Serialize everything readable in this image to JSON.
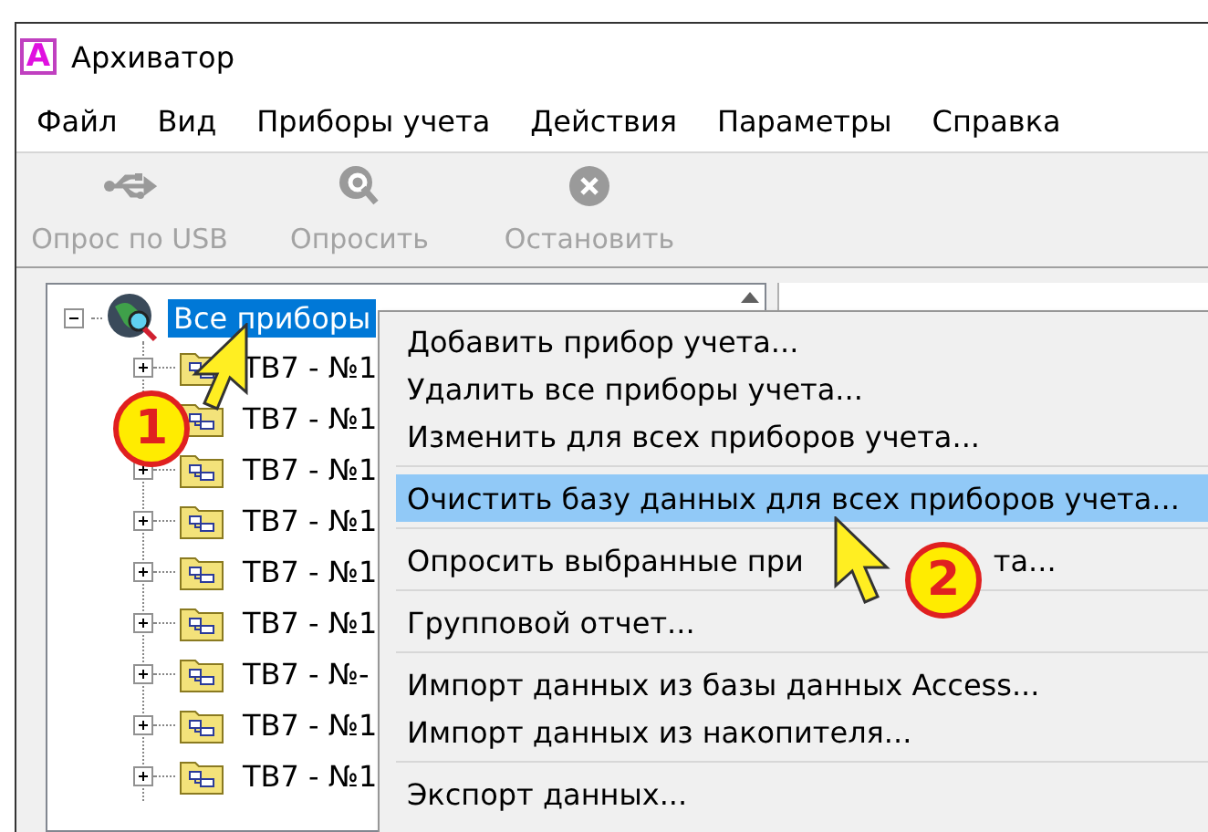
{
  "window": {
    "app_icon": "A",
    "title": "Архиватор"
  },
  "menu_bar": [
    "Файл",
    "Вид",
    "Приборы учета",
    "Действия",
    "Параметры",
    "Справка"
  ],
  "toolbar": [
    {
      "kind": "usb",
      "label": "Опрос по USB",
      "disabled": true
    },
    {
      "kind": "search",
      "label": "Опросить",
      "disabled": true
    },
    {
      "kind": "stop",
      "label": "Остановить",
      "disabled": true
    }
  ],
  "tree": {
    "label": "Все приборы",
    "selected": true,
    "expanded": true,
    "children": [
      {
        "label": "ТВ7 - №1",
        "expanded": false
      },
      {
        "label": "ТВ7 - №1",
        "expanded": false
      },
      {
        "label": "ТВ7 - №1",
        "expanded": false
      },
      {
        "label": "ТВ7 - №1",
        "expanded": false
      },
      {
        "label": "ТВ7 - №1",
        "expanded": false
      },
      {
        "label": "ТВ7 - №1",
        "expanded": false
      },
      {
        "label": "ТВ7 - №-",
        "expanded": false
      },
      {
        "label": "ТВ7 - №1",
        "expanded": false
      },
      {
        "label": "ТВ7 - №1",
        "expanded": false
      }
    ]
  },
  "context_menu": [
    {
      "kind": "item",
      "label": "Добавить прибор учета...",
      "selected": false
    },
    {
      "kind": "item",
      "label": "Удалить все приборы учета...",
      "selected": false
    },
    {
      "kind": "item",
      "label": "Изменить для всех приборов учета...",
      "selected": false
    },
    {
      "kind": "separator"
    },
    {
      "kind": "item",
      "label": "Очистить базу данных для всех приборов учета...",
      "selected": true
    },
    {
      "kind": "separator"
    },
    {
      "kind": "item",
      "label": "Опросить выбранные при",
      "tail": "та...",
      "selected": false
    },
    {
      "kind": "separator"
    },
    {
      "kind": "item",
      "label": "Групповой отчет...",
      "selected": false
    },
    {
      "kind": "separator"
    },
    {
      "kind": "item",
      "label": "Импорт данных из базы данных Access...",
      "selected": false
    },
    {
      "kind": "item",
      "label": "Импорт данных из накопителя...",
      "selected": false
    },
    {
      "kind": "separator"
    },
    {
      "kind": "item",
      "label": "Экспорт данных...",
      "selected": false
    }
  ],
  "callouts": [
    {
      "label": "1"
    },
    {
      "label": "2"
    }
  ]
}
